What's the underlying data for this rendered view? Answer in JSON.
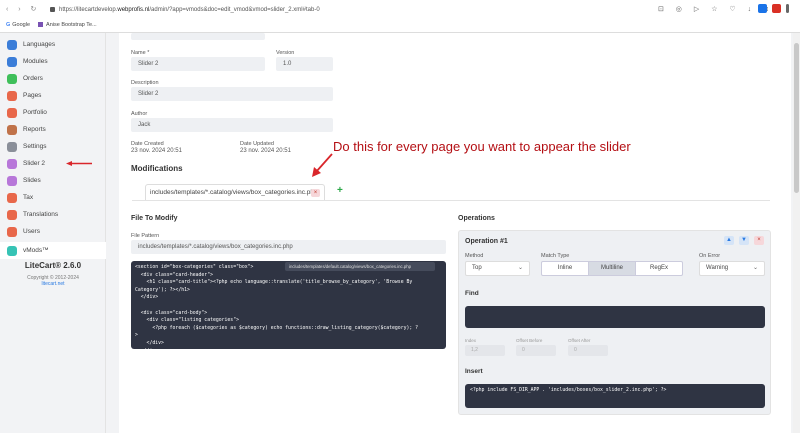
{
  "browser": {
    "nav_icons": "‹ › ↻",
    "url_prefix": "https://litecartdevelop.",
    "url_domain": "webprofis.nl",
    "url_suffix": "/admin/?app=vmods&doc=edit_vmod&vmod=slider_2.xml#tab-0",
    "bookmarks": [
      {
        "icon": "G",
        "label": "Google"
      },
      {
        "label": "Anise Bootstrap Te..."
      }
    ],
    "toolbar_icons": "⊡ ◎ ▷ ☆ ♡ ↓ ⧉"
  },
  "sidebar": {
    "items": [
      {
        "label": "Languages",
        "color": "#3b7dd8"
      },
      {
        "label": "Modules",
        "color": "#3b7dd8"
      },
      {
        "label": "Orders",
        "color": "#3fbf5a"
      },
      {
        "label": "Pages",
        "color": "#e8674a"
      },
      {
        "label": "Portfolio",
        "color": "#e8674a"
      },
      {
        "label": "Reports",
        "color": "#c0724a"
      },
      {
        "label": "Settings",
        "color": "#8a8f99"
      },
      {
        "label": "Slider 2",
        "color": "#b777d9"
      },
      {
        "label": "Slides",
        "color": "#b777d9"
      },
      {
        "label": "Tax",
        "color": "#e8674a"
      },
      {
        "label": "Translations",
        "color": "#e8674a"
      },
      {
        "label": "Users",
        "color": "#e8674a"
      },
      {
        "label": "vMods™",
        "color": "#36c3b5"
      }
    ],
    "version": "LiteCart® 2.6.0",
    "copyright": "Copyright © 2012-2024",
    "link": "litecart.net"
  },
  "form": {
    "name_label": "Name *",
    "name_value": "Slider 2",
    "version_label": "Version",
    "version_value": "1.0",
    "description_label": "Description",
    "description_value": "Slider 2",
    "author_label": "Author",
    "author_value": "Jack",
    "date_created_label": "Date Created",
    "date_created_value": "23 nov. 2024 20:51",
    "date_updated_label": "Date Updated",
    "date_updated_value": "23 nov. 2024 20:51"
  },
  "modifications": {
    "title": "Modifications",
    "tab_label": "includes/templates/*.catalog/views/box_categories.inc.php",
    "tab_close": "×",
    "add": "+"
  },
  "annotation": "Do this for every page you want to appear the slider",
  "file": {
    "title": "File To Modify",
    "pattern_label": "File Pattern",
    "pattern_value": "includes/templates/*.catalog/views/box_categories.inc.php",
    "code_badge": "includes/templates/default.catalog/views/box_categories.inc.php",
    "code": "<section id=\"box-categories\" class=\"box\">\n  <div class=\"card-header\">\n    <h1 class=\"card-title\"><?php echo language::translate('title_browse_by_category', 'Browse By\nCategory'); ?></h1>\n  </div>\n\n  <div class=\"card-body\">\n    <div class=\"listing categories\">\n      <?php foreach ($categories as $category) echo functions::draw_listing_category($category); ?\n>\n    </div>\n  </div>\n</section>"
  },
  "operations": {
    "title": "Operations",
    "op_title": "Operation #1",
    "method_label": "Method",
    "method_value": "Top",
    "match_label": "Match Type",
    "match_options": [
      "Inline",
      "Multiline",
      "RegEx"
    ],
    "match_selected": "Multiline",
    "onerror_label": "On Error",
    "onerror_value": "Warning",
    "find_label": "Find",
    "index_label": "Index",
    "index_value": "1,2",
    "offset_before_label": "Offset Before",
    "offset_before_value": "0",
    "offset_after_label": "Offset After",
    "offset_after_value": "0",
    "insert_label": "Insert",
    "insert_code": "<?php include FS_DIR_APP . 'includes/boxes/box_slider_2.inc.php'; ?>",
    "btn_up": "▲",
    "btn_down": "▼",
    "btn_remove": "×"
  },
  "colors": {
    "annotation": "#b40f14",
    "dark_code": "#2f3443",
    "remove": "#c0392b",
    "move": "#2a7ae2"
  }
}
